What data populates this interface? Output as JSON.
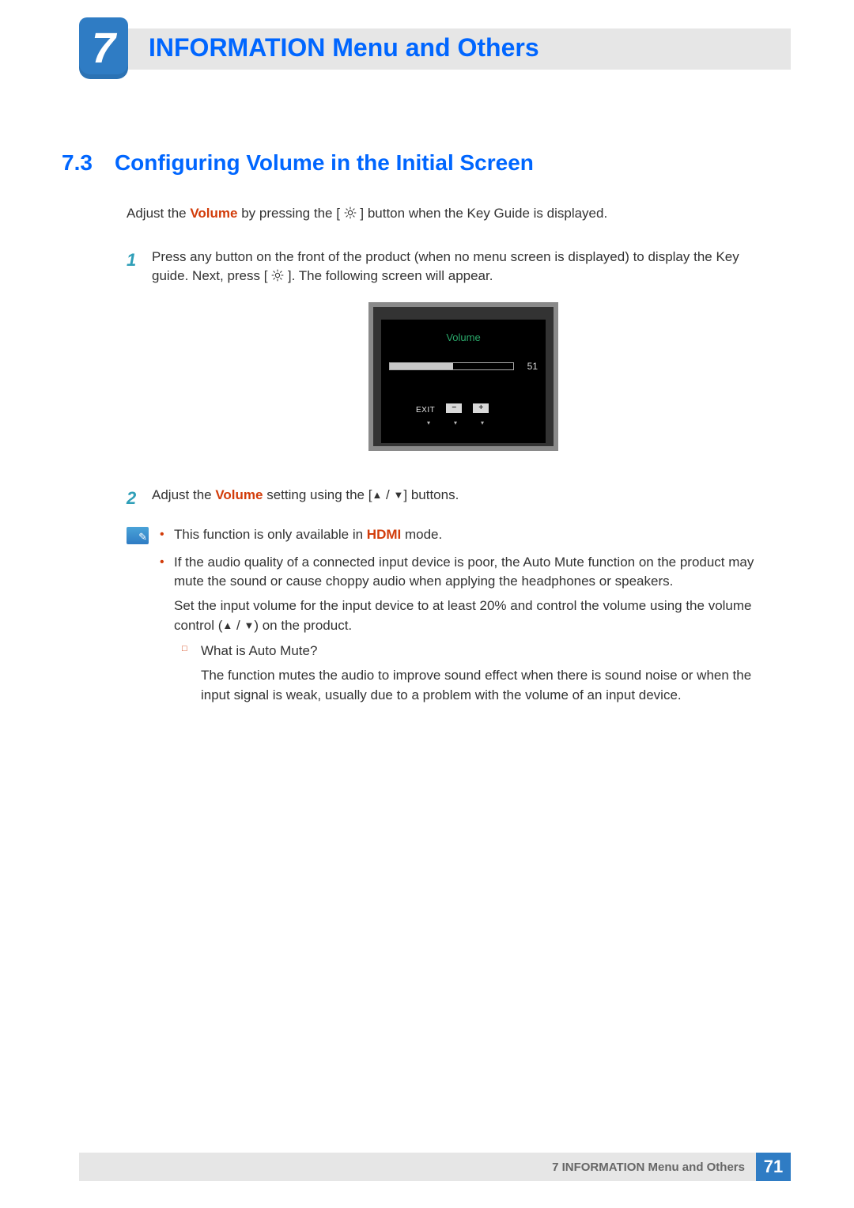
{
  "chapter": {
    "number": "7",
    "title": "INFORMATION Menu and Others"
  },
  "section": {
    "number": "7.3",
    "title": "Configuring Volume in the Initial Screen"
  },
  "intro": {
    "pre": "Adjust the ",
    "kw": "Volume",
    "post": " by pressing the [ ",
    "post2": " ] button when the Key Guide is displayed."
  },
  "step1": {
    "num": "1",
    "a": "Press any button on the front of the product (when no menu screen is displayed) to display the Key guide. Next, press [ ",
    "b": " ]. The following screen will appear."
  },
  "osd": {
    "title": "Volume",
    "value": "51",
    "fillPercent": "51%",
    "exit": "EXIT",
    "minus": "−",
    "plus": "+"
  },
  "step2": {
    "num": "2",
    "a": "Adjust the ",
    "kw": "Volume",
    "b": " setting using the [",
    "c": "] buttons."
  },
  "notes": {
    "b1": {
      "a": "This function is only available in ",
      "kw": "HDMI",
      "b": " mode."
    },
    "b2": {
      "p1": "If the audio quality of a connected input device is poor, the Auto Mute function on the product may mute the sound or cause choppy audio when applying the headphones or speakers.",
      "p2a": "Set the input volume for the input device to at least 20% and control the volume using the volume control (",
      "p2b": ") on the product."
    },
    "sub": {
      "q": "What is Auto Mute?",
      "a": "The function mutes the audio to improve sound effect when there is sound noise or when the input signal is weak, usually due to a problem with the volume of an input device."
    }
  },
  "footer": {
    "text": "7 INFORMATION Menu and Others",
    "page": "71"
  }
}
